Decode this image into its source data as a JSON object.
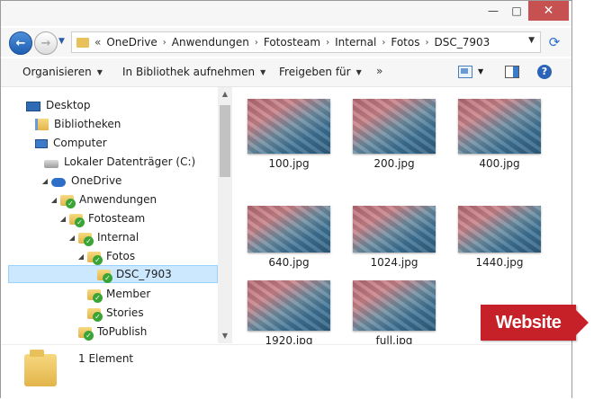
{
  "window": {
    "minimize_glyph": "—",
    "maximize_glyph": "□",
    "close_glyph": "✕"
  },
  "address": {
    "overflow": "«",
    "crumbs": [
      "OneDrive",
      "Anwendungen",
      "Fotosteam",
      "Internal",
      "Fotos",
      "DSC_7903"
    ],
    "separator": "›"
  },
  "toolbar": {
    "organize": "Organisieren",
    "library": "In Bibliothek aufnehmen",
    "share": "Freigeben für",
    "more": "»",
    "help": "?"
  },
  "tree": {
    "items": [
      {
        "label": "Desktop",
        "icon": "desktop-icon"
      },
      {
        "label": "Bibliotheken",
        "icon": "libraries-icon"
      },
      {
        "label": "Computer",
        "icon": "computer-icon"
      },
      {
        "label": "Lokaler Datenträger (C:)",
        "icon": "drive-icon"
      },
      {
        "label": "OneDrive",
        "icon": "onedrive-icon"
      },
      {
        "label": "Anwendungen",
        "icon": "folder-synced-icon"
      },
      {
        "label": "Fotosteam",
        "icon": "folder-synced-icon"
      },
      {
        "label": "Internal",
        "icon": "folder-synced-icon"
      },
      {
        "label": "Fotos",
        "icon": "folder-synced-icon"
      },
      {
        "label": "DSC_7903",
        "icon": "folder-synced-icon",
        "selected": true
      },
      {
        "label": "Member",
        "icon": "folder-synced-icon"
      },
      {
        "label": "Stories",
        "icon": "folder-synced-icon"
      },
      {
        "label": "ToPublish",
        "icon": "folder-synced-icon"
      }
    ]
  },
  "files": [
    "100.jpg",
    "200.jpg",
    "400.jpg",
    "640.jpg",
    "1024.jpg",
    "1440.jpg",
    "1920.jpg",
    "full.jpg"
  ],
  "status": {
    "count": "1 Element"
  },
  "badge": {
    "label": "Website",
    "color": "#c62128"
  }
}
